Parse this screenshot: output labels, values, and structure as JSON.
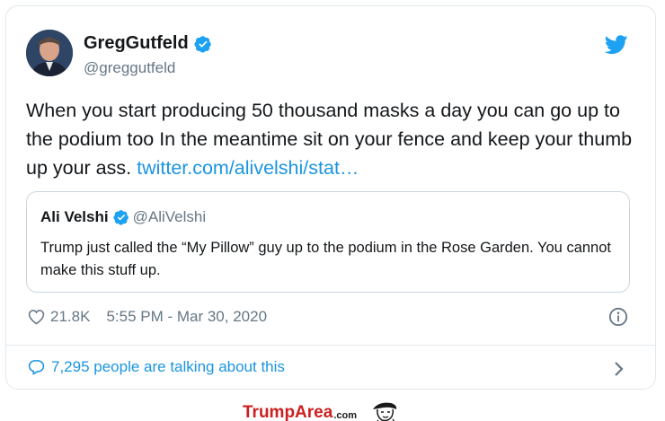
{
  "tweet": {
    "author_name": "GregGutfeld",
    "author_handle": "@greggutfeld",
    "body_text": "When you start producing 50 thousand masks a day you can go up to the podium too In the meantime sit on your fence and keep your thumb up your ass. ",
    "body_link": "twitter.com/alivelshi/stat…",
    "likes": "21.8K",
    "timestamp": "5:55 PM - Mar 30, 2020",
    "talking": "7,295 people are talking about this"
  },
  "quote": {
    "author_name": "Ali Velshi",
    "author_handle": "@AliVelshi",
    "text": "Trump just called the “My Pillow” guy up to the podium in the Rose Garden. You cannot make this stuff up."
  },
  "watermark": {
    "brand": "TrumpArea",
    "suffix": ".com"
  },
  "colors": {
    "link": "#1b95e0",
    "secondary_text": "#657786",
    "border": "#e1e8ed",
    "watermark_red": "#cc1f1f"
  },
  "icons": [
    "verified-badge-icon",
    "twitter-bird-icon",
    "heart-icon",
    "info-icon",
    "comment-bubble-icon",
    "chevron-right-icon",
    "caricature-face-icon"
  ]
}
